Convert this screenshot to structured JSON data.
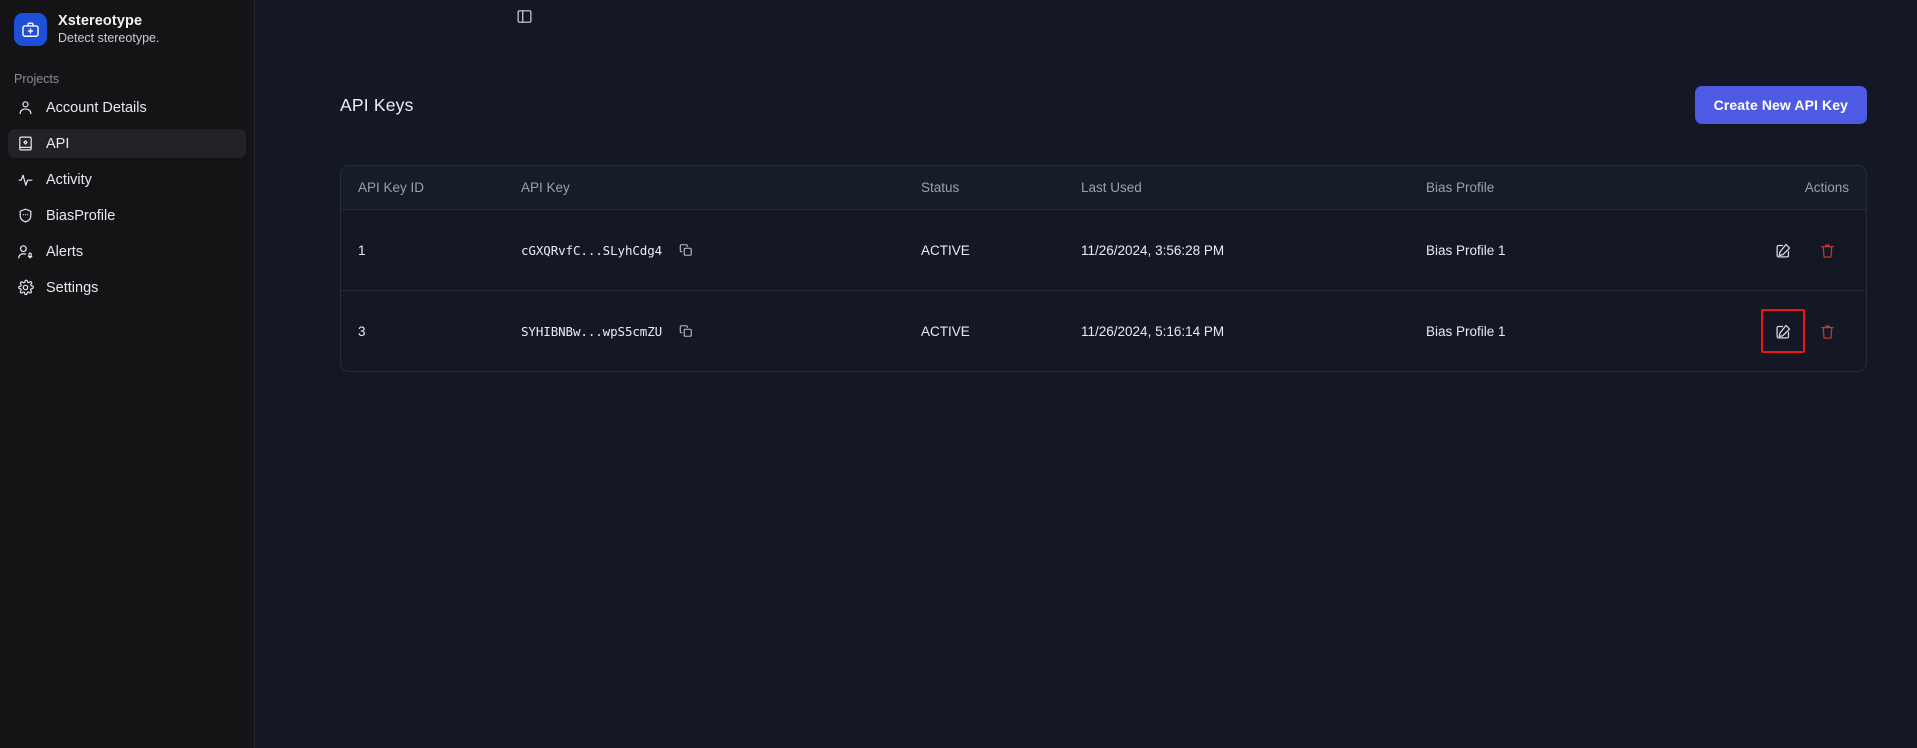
{
  "brand": {
    "title": "Xstereotype",
    "subtitle": "Detect stereotype.",
    "logo_icon": "medical-briefcase-icon",
    "logo_color": "#1f4fd8"
  },
  "sidebar": {
    "section_label": "Projects",
    "items": [
      {
        "label": "Account Details",
        "icon": "user-icon",
        "active": false
      },
      {
        "label": "API",
        "icon": "api-book-icon",
        "active": true
      },
      {
        "label": "Activity",
        "icon": "activity-pulse-icon",
        "active": false
      },
      {
        "label": "BiasProfile",
        "icon": "shield-icon",
        "active": false
      },
      {
        "label": "Alerts",
        "icon": "user-alert-icon",
        "active": false
      },
      {
        "label": "Settings",
        "icon": "gear-icon",
        "active": false
      }
    ]
  },
  "panel_toggle": {
    "icon": "sidebar-panel-icon"
  },
  "main": {
    "page_title": "API Keys",
    "create_button": "Create New API Key",
    "accent_color": "#4f5ae4",
    "table": {
      "columns": [
        "API Key ID",
        "API Key",
        "Status",
        "Last Used",
        "Bias Profile",
        "Actions"
      ],
      "rows": [
        {
          "id": "1",
          "key": "cGXQRvfC...SLyhCdg4",
          "status": "ACTIVE",
          "last_used": "11/26/2024, 3:56:28 PM",
          "bias_profile": "Bias Profile 1",
          "copy_icon": "copy-icon",
          "edit_icon": "edit-icon",
          "delete_icon": "trash-icon",
          "edit_highlighted": false
        },
        {
          "id": "3",
          "key": "SYHIBNBw...wpS5cmZU",
          "status": "ACTIVE",
          "last_used": "11/26/2024, 5:16:14 PM",
          "bias_profile": "Bias Profile 1",
          "copy_icon": "copy-icon",
          "edit_icon": "edit-icon",
          "delete_icon": "trash-icon",
          "edit_highlighted": true
        }
      ]
    },
    "highlight_color": "#ee1515"
  }
}
